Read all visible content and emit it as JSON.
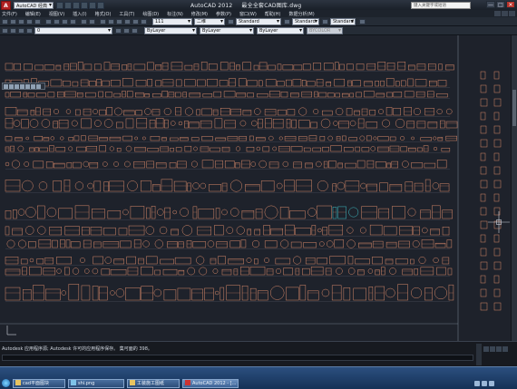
{
  "titlebar": {
    "app_button": "A",
    "workspace": "AutoCAD 经典",
    "app_name": "AutoCAD 2012",
    "file_name": "最全全套CAD图库.dwg",
    "search_placeholder": "键入关键字或短语",
    "controls": [
      "—",
      "□",
      "✕"
    ]
  },
  "menubar": {
    "items": [
      "文件(F)",
      "编辑(E)",
      "视图(V)",
      "插入(I)",
      "格式(O)",
      "工具(T)",
      "绘图(D)",
      "标注(N)",
      "修改(M)",
      "参数(P)",
      "窗口(W)",
      "帮助(H)",
      "数据分析(M)"
    ]
  },
  "toolbar1": {
    "layer_dropdown": "111",
    "view_dropdown": "二维",
    "text_style": "Standard",
    "dim_style": "Standard",
    "table_style": "Standard"
  },
  "toolbar2": {
    "layer_state": "0",
    "color": "ByLayer",
    "linetype": "ByLayer",
    "lineweight": "ByLayer",
    "plot_style": "BYCOLOR"
  },
  "command": {
    "history": "Autodesk 应用程序源; Autodesk 许可的应用程序保存。 集可面的 398。",
    "prompt": ""
  },
  "taskbar": {
    "items": [
      {
        "label": "cad平面图块",
        "active": false
      },
      {
        "label": "shi.png",
        "active": false
      },
      {
        "label": "工装施工图纸",
        "active": false
      },
      {
        "label": "AutoCAD 2012 - [...",
        "active": true
      }
    ]
  },
  "colors": {
    "drawing_bg": "#1e222b",
    "block_lines": "#d98a6a",
    "highlight": "#3fc1c9",
    "crosshair": "#d0d6df"
  },
  "icons": [
    "app-logo-icon",
    "search-icon",
    "minimize-icon",
    "maximize-icon",
    "close-icon",
    "start-orb-icon"
  ]
}
